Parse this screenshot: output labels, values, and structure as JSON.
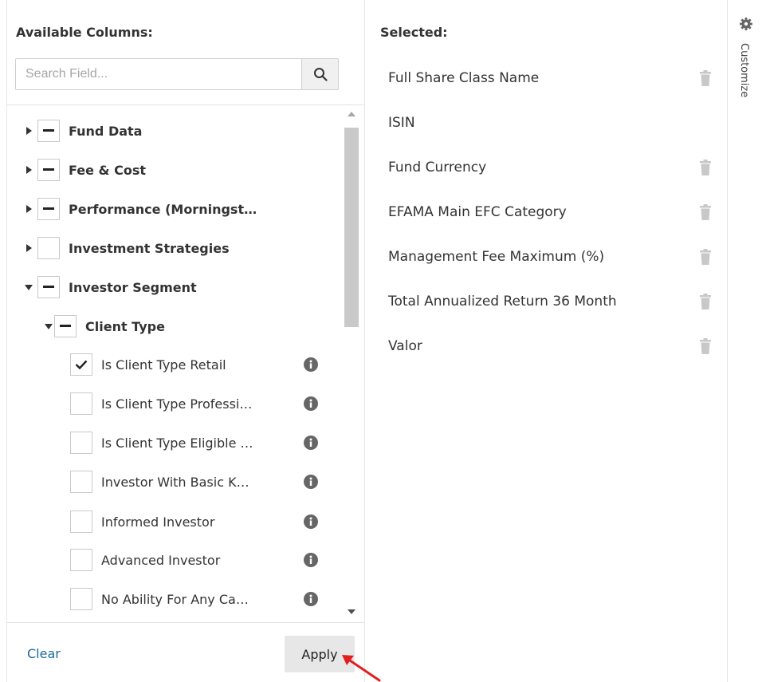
{
  "available": {
    "title": "Available Columns:",
    "search_placeholder": "Search Field...",
    "tree": [
      {
        "label": "Fund Data",
        "caret": "right",
        "check": "partial",
        "bold": true,
        "info": false,
        "level": 0
      },
      {
        "label": "Fee & Cost",
        "caret": "right",
        "check": "partial",
        "bold": true,
        "info": false,
        "level": 0
      },
      {
        "label": "Performance (Morningst…",
        "caret": "right",
        "check": "partial",
        "bold": true,
        "info": false,
        "level": 0
      },
      {
        "label": "Investment Strategies",
        "caret": "right",
        "check": "none",
        "bold": true,
        "info": false,
        "level": 0
      },
      {
        "label": "Investor Segment",
        "caret": "down",
        "check": "partial",
        "bold": true,
        "info": false,
        "level": 0
      },
      {
        "label": "Client Type",
        "caret": "down",
        "check": "partial",
        "bold": true,
        "info": false,
        "level": 1
      },
      {
        "label": "Is Client Type Retail",
        "caret": "none",
        "check": "checked",
        "bold": false,
        "info": true,
        "level": 2
      },
      {
        "label": "Is Client Type Professi…",
        "caret": "none",
        "check": "none",
        "bold": false,
        "info": true,
        "level": 2
      },
      {
        "label": "Is Client Type Eligible …",
        "caret": "none",
        "check": "none",
        "bold": false,
        "info": true,
        "level": 2
      },
      {
        "label": "Investor With Basic K…",
        "caret": "none",
        "check": "none",
        "bold": false,
        "info": true,
        "level": 2
      },
      {
        "label": "Informed Investor",
        "caret": "none",
        "check": "none",
        "bold": false,
        "info": true,
        "level": 2
      },
      {
        "label": "Advanced Investor",
        "caret": "none",
        "check": "none",
        "bold": false,
        "info": true,
        "level": 2
      },
      {
        "label": "No Ability For Any Ca…",
        "caret": "none",
        "check": "none",
        "bold": false,
        "info": true,
        "level": 2
      }
    ],
    "clear_label": "Clear",
    "apply_label": "Apply"
  },
  "selected": {
    "title": "Selected:",
    "items": [
      {
        "label": "Full Share Class Name",
        "removable": true
      },
      {
        "label": "ISIN",
        "removable": false
      },
      {
        "label": "Fund Currency",
        "removable": true
      },
      {
        "label": "EFAMA Main EFC Category",
        "removable": true
      },
      {
        "label": "Management Fee Maximum (%)",
        "removable": true
      },
      {
        "label": "Total Annualized Return 36 Month",
        "removable": true
      },
      {
        "label": "Valor",
        "removable": true
      }
    ]
  },
  "customize": {
    "label": "Customize",
    "icon": "gear-icon"
  },
  "colors": {
    "link": "#1a6c9c",
    "annotation": "#e02020",
    "icon_gray": "#666666",
    "trash_gray": "#c8c8c8",
    "scroll_thumb": "#c9c9c9"
  }
}
